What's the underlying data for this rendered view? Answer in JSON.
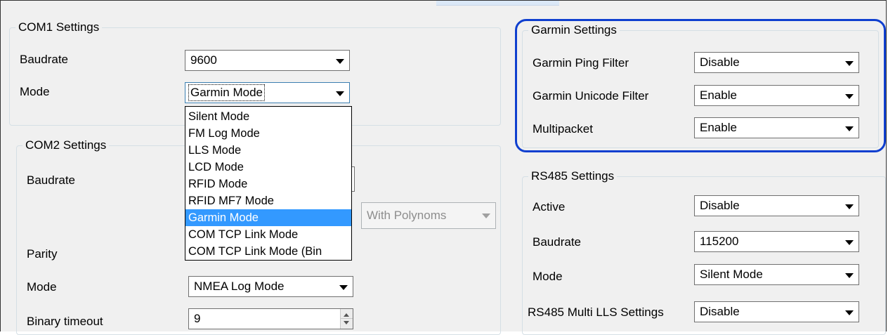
{
  "com1": {
    "title": "COM1 Settings",
    "baudrate_label": "Baudrate",
    "baudrate_value": "9600",
    "mode_label": "Mode",
    "mode_value": "Garmin Mode",
    "mode_options": [
      "Silent Mode",
      "FM Log Mode",
      "LLS Mode",
      "LCD Mode",
      "RFID Mode",
      "RFID MF7 Mode",
      "Garmin Mode",
      "COM TCP Link Mode",
      "COM TCP Link Mode (Bin"
    ],
    "selected_option_index": 6
  },
  "com2": {
    "title": "COM2 Settings",
    "baudrate_label": "Baudrate",
    "polynoms_value": "With Polynoms",
    "parity_label": "Parity",
    "mode_label": "Mode",
    "mode_value": "NMEA Log Mode",
    "binary_timeout_label": "Binary timeout",
    "binary_timeout_value": "9"
  },
  "garmin": {
    "title": "Garmin Settings",
    "ping_filter_label": "Garmin Ping Filter",
    "ping_filter_value": "Disable",
    "unicode_filter_label": "Garmin Unicode Filter",
    "unicode_filter_value": "Enable",
    "multipacket_label": "Multipacket",
    "multipacket_value": "Enable"
  },
  "rs485": {
    "title": "RS485 Settings",
    "active_label": "Active",
    "active_value": "Disable",
    "baudrate_label": "Baudrate",
    "baudrate_value": "115200",
    "mode_label": "Mode",
    "mode_value": "Silent Mode",
    "multi_lls_label": "RS485 Multi LLS Settings",
    "multi_lls_value": "Disable"
  },
  "colors": {
    "highlight_ring": "#0f3fcf",
    "selection": "#3399ff",
    "panel_background": "#f0f0f0"
  }
}
